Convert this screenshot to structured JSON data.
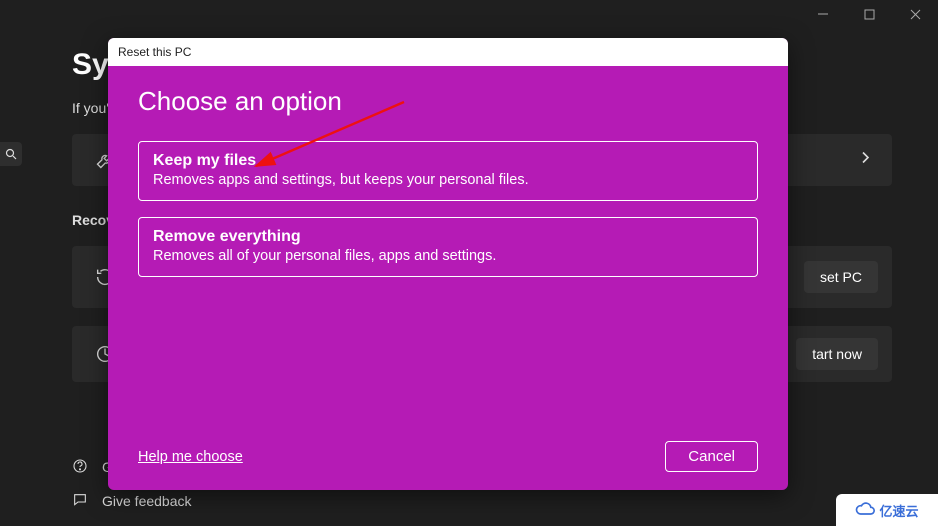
{
  "window": {
    "controls": {
      "min": "minimize",
      "max": "maximize",
      "close": "close"
    }
  },
  "background": {
    "title": "Sys",
    "subtitle": "If you'",
    "section_label": "Recov",
    "card_buttons": {
      "reset": "set PC",
      "start": "tart now"
    },
    "bottom_links": {
      "help": "G",
      "feedback": "Give feedback"
    }
  },
  "modal": {
    "titlebar": "Reset this PC",
    "heading": "Choose an option",
    "options": [
      {
        "title": "Keep my files",
        "desc": "Removes apps and settings, but keeps your personal files."
      },
      {
        "title": "Remove everything",
        "desc": "Removes all of your personal files, apps and settings."
      }
    ],
    "help_link": "Help me choose",
    "cancel": "Cancel"
  },
  "watermark": "亿速云"
}
